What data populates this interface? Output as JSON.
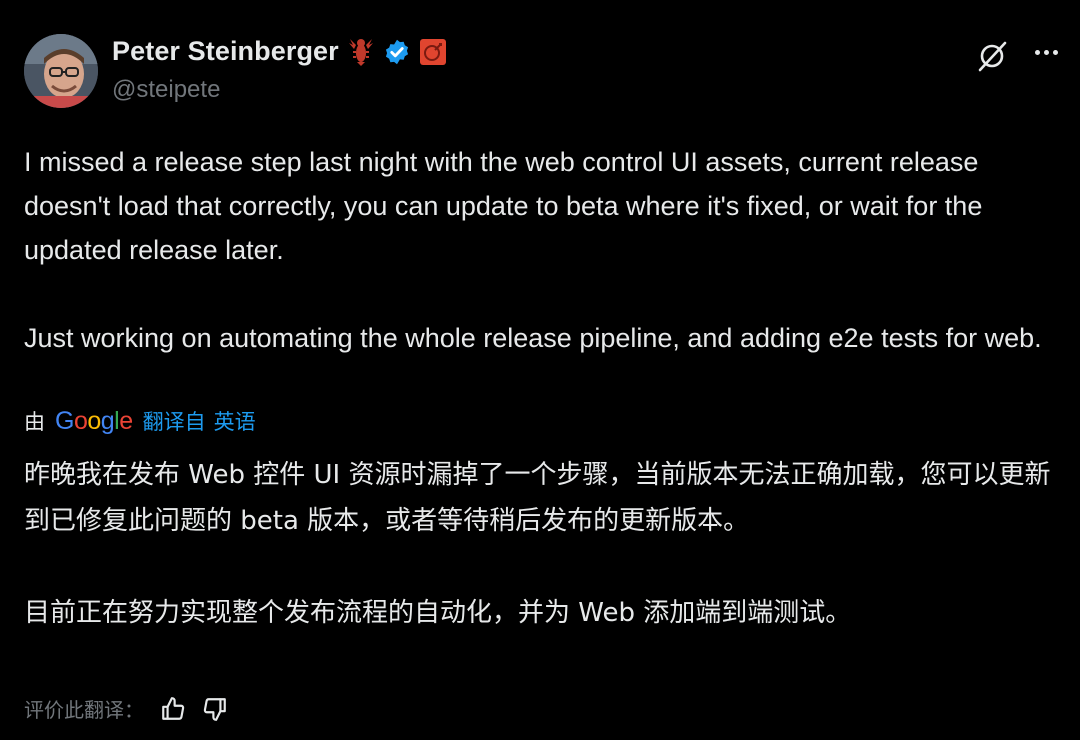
{
  "author": {
    "name": "Peter Steinberger",
    "handle": "@steipete",
    "badges": [
      "lobster-icon",
      "verified-badge-icon",
      "affiliate-badge-icon"
    ]
  },
  "actions": {
    "grok_icon": "grok-icon",
    "more_icon": "more-icon"
  },
  "tweet": {
    "paragraphs": [
      "I missed a release step last night with the web control UI assets, current release doesn't load that correctly, you can update to beta where it's fixed, or wait for the updated release later.",
      "Just working on automating the whole release pipeline, and adding e2e tests for web."
    ]
  },
  "translation": {
    "by_label": "由",
    "provider": "Google",
    "translated_from_label": "翻译自",
    "source_language": "英语",
    "paragraphs": [
      "昨晚我在发布 Web 控件 UI 资源时漏掉了一个步骤，当前版本无法正确加载，您可以更新到已修复此问题的 beta 版本，或者等待稍后发布的更新版本。",
      "目前正在努力实现整个发布流程的自动化，并为 Web 添加端到端测试。"
    ],
    "rate_label": "评价此翻译："
  },
  "colors": {
    "background": "#000000",
    "text": "#e7e9ea",
    "secondary": "#71767b",
    "link": "#1d9bf0",
    "verified": "#1d9bf0"
  }
}
